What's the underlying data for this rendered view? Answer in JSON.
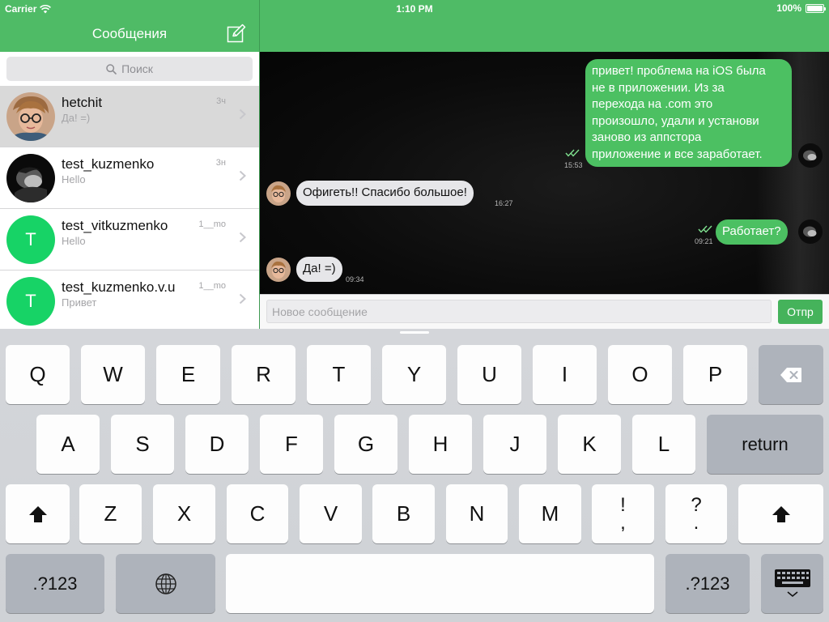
{
  "status_bar": {
    "carrier": "Carrier",
    "time": "1:10 PM",
    "battery": "100%",
    "battery_level": 1.0
  },
  "left_nav": {
    "title": "Сообщения",
    "compose_icon": "compose-icon"
  },
  "search": {
    "placeholder": "Поиск",
    "icon": "search-icon"
  },
  "conversations": [
    {
      "name": "hetchit",
      "preview": "Да! =)",
      "time": "3ч",
      "avatar": "photo",
      "selected": true
    },
    {
      "name": "test_kuzmenko",
      "preview": "Hello",
      "time": "3н",
      "avatar": "photo"
    },
    {
      "name": "test_vitkuzmenko",
      "preview": "Hello",
      "time": "1__mo",
      "avatar": "T"
    },
    {
      "name": "test_kuzmenko.v.u",
      "preview": "Привет",
      "time": "1__mo",
      "avatar": "T"
    }
  ],
  "messages": [
    {
      "direction": "out",
      "lines": [
        "привет! проблема на iOS была",
        "не в приложении. Из за",
        "перехода на .com это",
        "произошло, удали и установи",
        "заново из аппстора",
        "приложение и все заработает."
      ],
      "time": "15:53",
      "read_ticks": true
    },
    {
      "direction": "in",
      "lines": [
        "Офигеть!! Спасибо большое!"
      ],
      "time": "16:27"
    },
    {
      "direction": "out",
      "lines": [
        "Работает?"
      ],
      "time": "09:21",
      "read_ticks": true
    },
    {
      "direction": "in",
      "lines": [
        "Да! =)"
      ],
      "time": "09:34"
    }
  ],
  "composer": {
    "placeholder": "Новое сообщение",
    "send_label": "Отпр"
  },
  "keyboard": {
    "row1": [
      "Q",
      "W",
      "E",
      "R",
      "T",
      "Y",
      "U",
      "I",
      "O",
      "P"
    ],
    "row2": [
      "A",
      "S",
      "D",
      "F",
      "G",
      "H",
      "J",
      "K",
      "L"
    ],
    "return_label": "return",
    "row3": [
      "Z",
      "X",
      "C",
      "V",
      "B",
      "N",
      "M"
    ],
    "punct1": [
      "!",
      ","
    ],
    "punct2": [
      "?",
      "."
    ],
    "numbers_label": ".?123",
    "globe_icon": "globe-icon",
    "dismiss_icon": "keyboard-dismiss-icon",
    "delete_icon": "delete-icon",
    "shift_icon": "shift-icon"
  },
  "colors": {
    "nav_green": "#4fbb66",
    "bubble_out": "#4cc062",
    "bubble_in": "#e6e6e9",
    "avatar_green": "#17d366"
  }
}
